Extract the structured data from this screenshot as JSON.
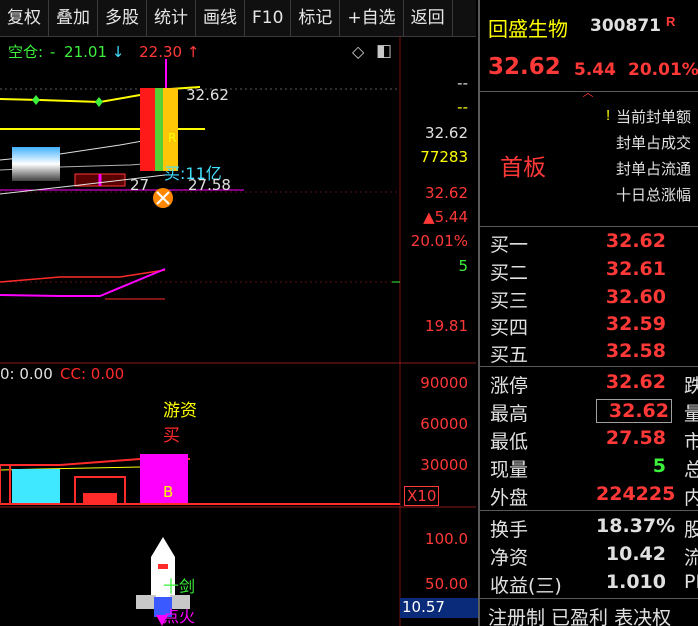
{
  "toolbar": {
    "items": [
      "复权",
      "叠加",
      "多股",
      "统计",
      "画线",
      "F10",
      "标记",
      "+自选",
      "返回"
    ]
  },
  "chart": {
    "legend": {
      "label": "空仓:",
      "dash": "-",
      "v1": "21.01",
      "down_arrow": "↓",
      "v2": "22.30",
      "up_arrow": "↑"
    },
    "price_labels": {
      "top_right": "32.62",
      "limit_rmb": "27",
      "low": "27.58",
      "buy_note": "买:11亿"
    },
    "right_axis": {
      "dash1": "--",
      "dash2": "--",
      "price": "32.62",
      "vol": "77283",
      "price2": "32.62",
      "change": "▲5.44",
      "pct": "20.01%",
      "small": "5",
      "low": "19.81"
    },
    "indicator_legend": {
      "a": "0: 0.00",
      "b": "CC: 0.00"
    },
    "vol_labels": {
      "youzi": "游资",
      "mai": "买",
      "b": "B"
    },
    "vol_axis": [
      "90000",
      "60000",
      "30000"
    ],
    "vol_unit": "X10",
    "lower_labels": {
      "t1": "十剑",
      "t2": "点火"
    },
    "lower_axis": [
      "100.0",
      "50.00"
    ],
    "lower_value": "10.57",
    "colors": {
      "up": "#ff3838",
      "down": "#3cf03c",
      "yellow": "#ffff00",
      "magenta": "#ff00ff",
      "cyan": "#40e0ff"
    }
  },
  "panel": {
    "name": "回盛生物",
    "code": "300871",
    "r": "R",
    "price": "32.62",
    "change": "5.44",
    "pct": "20.01%",
    "tag": "首板",
    "info": [
      "当前封单额",
      "封单占成交",
      "封单占流通",
      "十日总涨幅"
    ],
    "info_marker": "!",
    "bids": [
      {
        "label": "买一",
        "value": "32.62"
      },
      {
        "label": "买二",
        "value": "32.61"
      },
      {
        "label": "买三",
        "value": "32.60"
      },
      {
        "label": "买四",
        "value": "32.59"
      },
      {
        "label": "买五",
        "value": "32.58"
      }
    ],
    "stats": [
      {
        "label": "涨停",
        "value": "32.62",
        "extra": "跌"
      },
      {
        "label": "最高",
        "value": "32.62",
        "extra": "量"
      },
      {
        "label": "最低",
        "value": "27.58",
        "extra": "市"
      },
      {
        "label": "现量",
        "value": "5",
        "extra": "总"
      },
      {
        "label": "外盘",
        "value": "224225",
        "extra": "内"
      }
    ],
    "fund": [
      {
        "label": "换手",
        "value": "18.37%",
        "extra": "股"
      },
      {
        "label": "净资",
        "value": "10.42",
        "extra": "流"
      },
      {
        "label": "收益(三)",
        "value": "1.010",
        "extra": "PE"
      }
    ],
    "footer": "注册制 已盈利 表决权"
  }
}
